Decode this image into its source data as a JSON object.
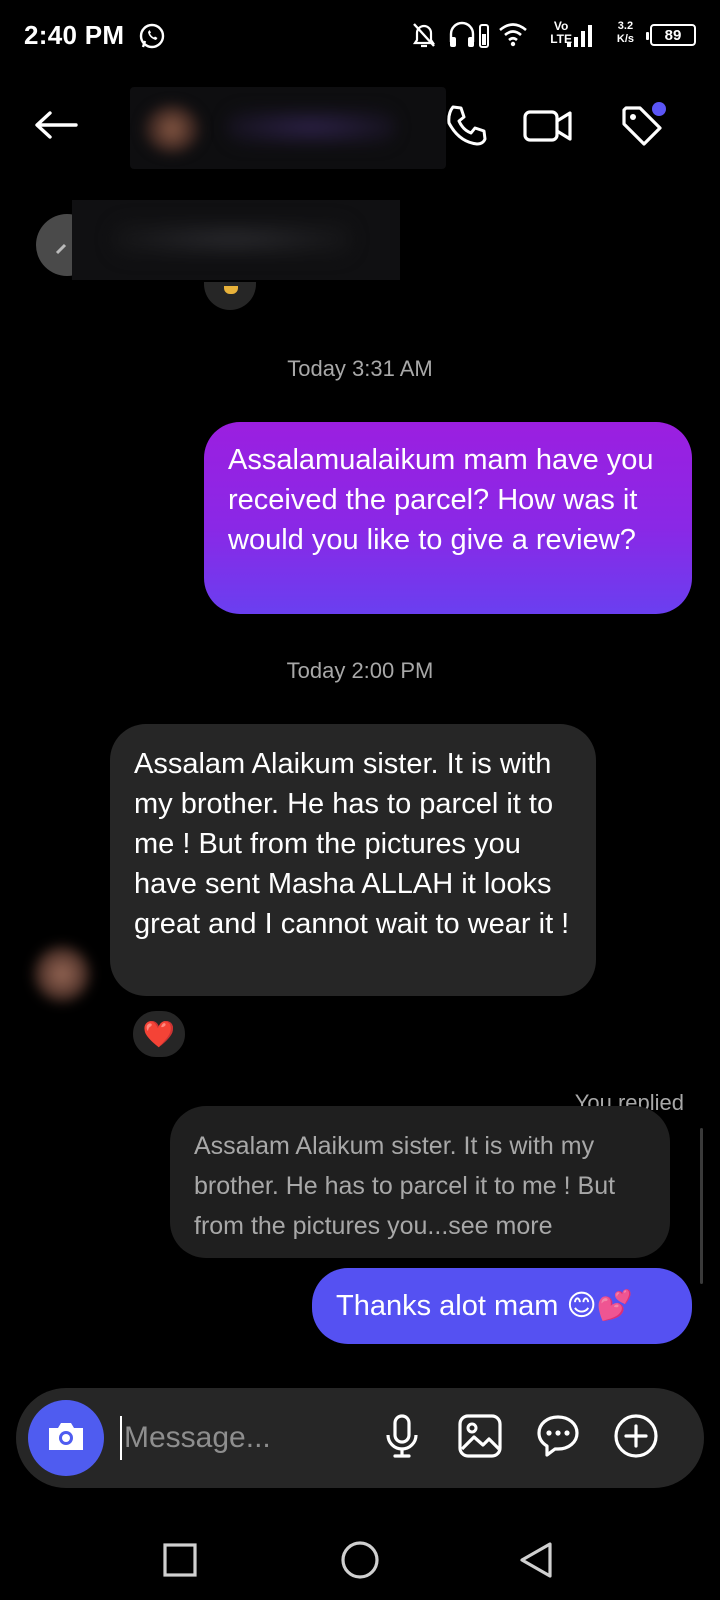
{
  "status_bar": {
    "time": "2:40 PM",
    "volte_top": "Vo",
    "volte_bottom": "LTE",
    "net_speed_top": "3.2",
    "net_speed_bottom": "K/s",
    "battery": "89"
  },
  "header": {
    "icons": [
      "back-arrow-icon",
      "phone-icon",
      "video-call-icon",
      "tag-icon"
    ],
    "accent_dot_color": "#5b55f5"
  },
  "messages": {
    "timestamp_1": "Today 3:31 AM",
    "sent_1": "Assalamualaikum mam have you received the parcel? How was it would you like to give a review?",
    "timestamp_2": "Today 2:00 PM",
    "received_1": "Assalam Alaikum sister. It is with my brother. He has to parcel it to me ! But from the pictures you have sent Masha ALLAH it looks great and I cannot wait to wear it !",
    "reaction": "❤️",
    "you_replied_label": "You replied",
    "reply_quote": "Assalam Alaikum sister. It is with my brother. He has to parcel it to me ! But from the pictures you...see more",
    "sent_2": "Thanks alot mam 😊💕"
  },
  "composer": {
    "placeholder": "Message...",
    "icons": [
      "camera-icon",
      "microphone-icon",
      "gallery-icon",
      "sticker-chat-icon",
      "add-icon"
    ],
    "camera_color": "#4f5cf0"
  },
  "colors": {
    "sent_gradient_top": "#9b1fe0",
    "sent_gradient_bottom": "#6a3ff0",
    "last_sent": "#5551f2",
    "received": "#262626"
  }
}
